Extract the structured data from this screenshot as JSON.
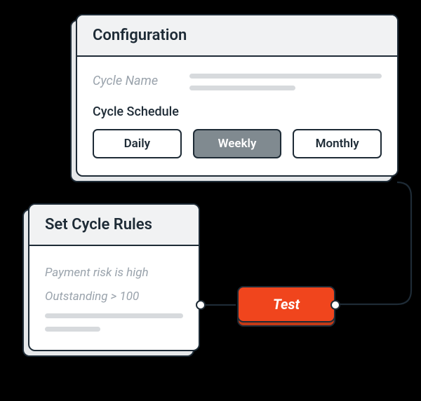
{
  "config": {
    "title": "Configuration",
    "cycleNameLabel": "Cycle Name",
    "scheduleLabel": "Cycle Schedule",
    "schedule": {
      "options": [
        "Daily",
        "Weekly",
        "Monthly"
      ],
      "selected": "Weekly"
    }
  },
  "rules": {
    "title": "Set Cycle Rules",
    "items": [
      "Payment risk is high",
      "Outstanding > 100"
    ]
  },
  "testButton": {
    "label": "Test"
  },
  "colors": {
    "accent": "#f0451d",
    "stroke": "#1e2b36",
    "muted": "#9aa3ac",
    "segActive": "#808a90"
  }
}
